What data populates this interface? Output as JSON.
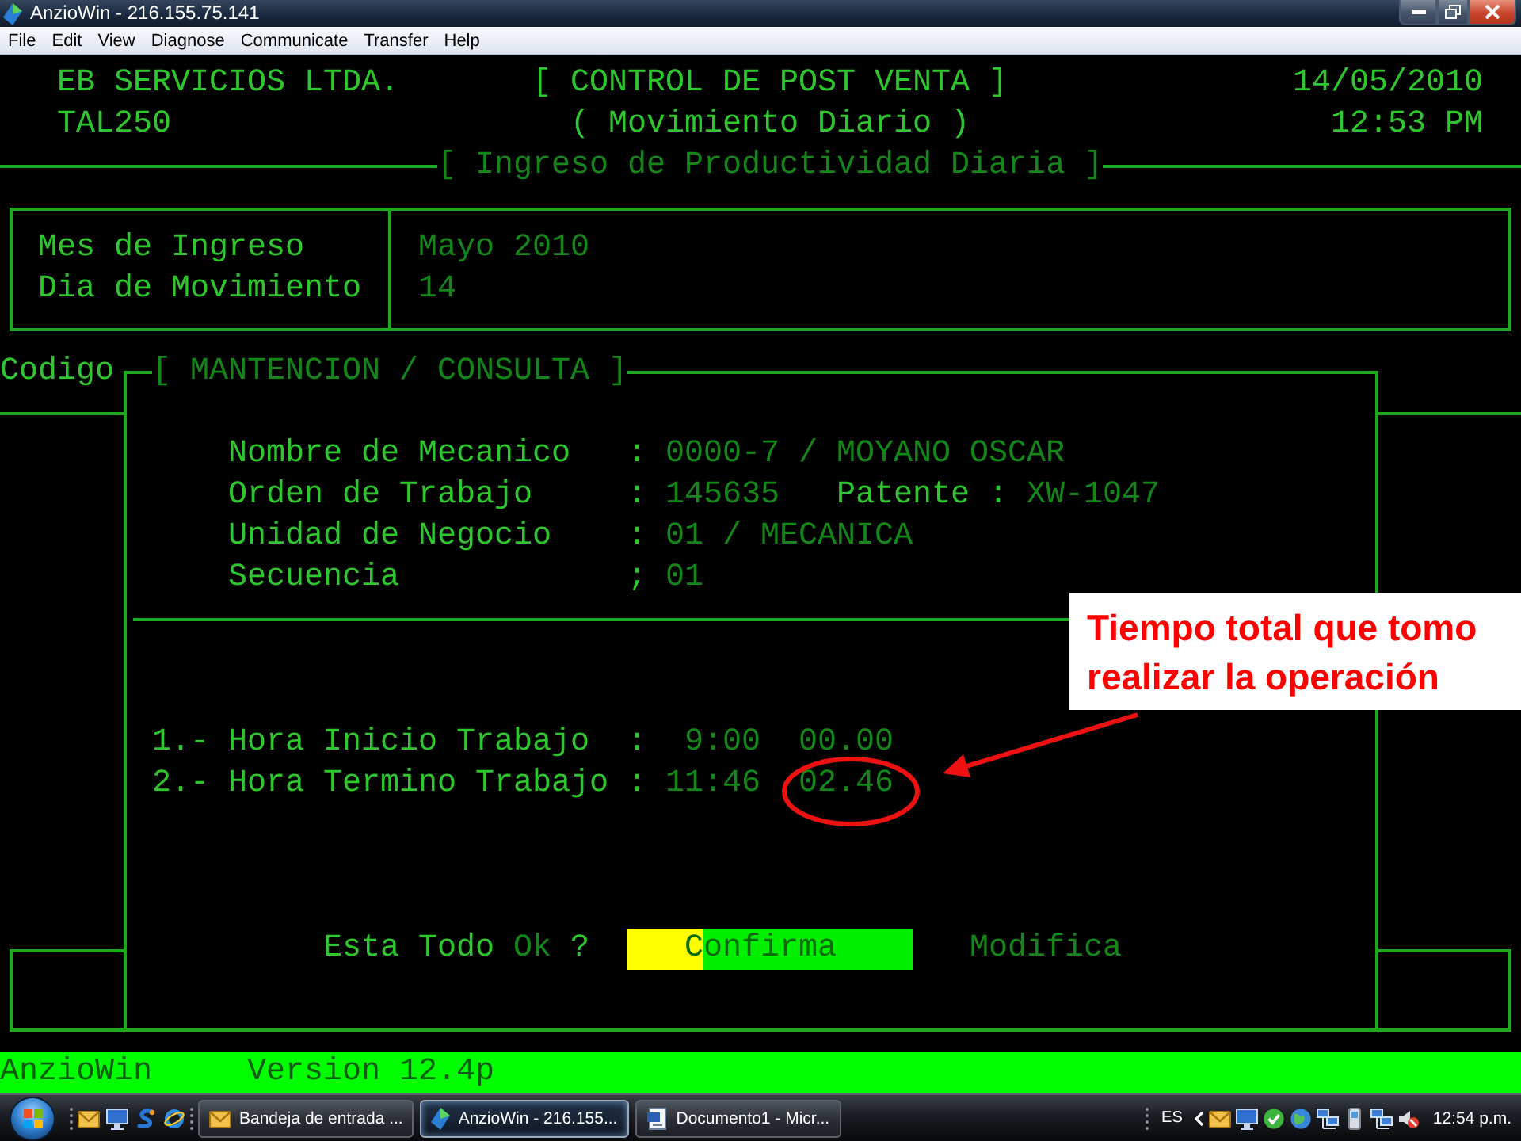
{
  "window": {
    "title": "AnzioWin - 216.155.75.141"
  },
  "menu": [
    "File",
    "Edit",
    "View",
    "Diagnose",
    "Communicate",
    "Transfer",
    "Help"
  ],
  "header": {
    "company": "EB SERVICIOS LTDA.",
    "program": "TAL250",
    "title": "[ CONTROL DE POST VENTA ]",
    "subtitle": "( Movimiento Diario )",
    "date": "14/05/2010",
    "time": "12:53 PM"
  },
  "section_title": "[ Ingreso de Productividad Diaria ]",
  "period": [
    {
      "label": "Mes de Ingreso",
      "value": "Mayo 2010"
    },
    {
      "label": "Dia de Movimiento",
      "value": "14"
    }
  ],
  "list_label": "Codigo",
  "dialog": {
    "title": "[ MANTENCION / CONSULTA ]",
    "fields": [
      {
        "label": "Nombre de Mecanico",
        "separator": ":",
        "value": "0000-7 / MOYANO OSCAR"
      },
      {
        "label": "Orden de Trabajo",
        "separator": ":",
        "value": "145635",
        "extra_label": "Patente :",
        "extra_value": "XW-1047"
      },
      {
        "label": "Unidad de Negocio",
        "separator": ":",
        "value": "01 / MECANICA"
      },
      {
        "label": "Secuencia",
        "separator": ";",
        "value": "01"
      }
    ],
    "times": [
      {
        "label": "1.- Hora Inicio Trabajo",
        "separator": ":",
        "time": "9:00",
        "duration": "00.00"
      },
      {
        "label": "2.- Hora Termino Trabajo",
        "separator": ":",
        "time": "11:46",
        "duration": "02.46"
      }
    ],
    "prompt": {
      "text": "Esta Todo",
      "hint": "Ok",
      "question": "?"
    },
    "options": [
      {
        "label": "Confirma",
        "selected": true
      },
      {
        "label": "Modifica",
        "selected": false
      }
    ]
  },
  "status_bar": {
    "app": "AnzioWin",
    "version": "Version 12.4p"
  },
  "annotation": {
    "text": "Tiempo total que tomo realizar la operación"
  },
  "taskbar": {
    "tasks": [
      {
        "label": "Bandeja de entrada ...",
        "selected": false
      },
      {
        "label": "AnzioWin - 216.155...",
        "selected": true
      },
      {
        "label": "Documento1 - Micr...",
        "selected": false
      }
    ],
    "language": "ES",
    "clock": "12:54 p.m."
  }
}
